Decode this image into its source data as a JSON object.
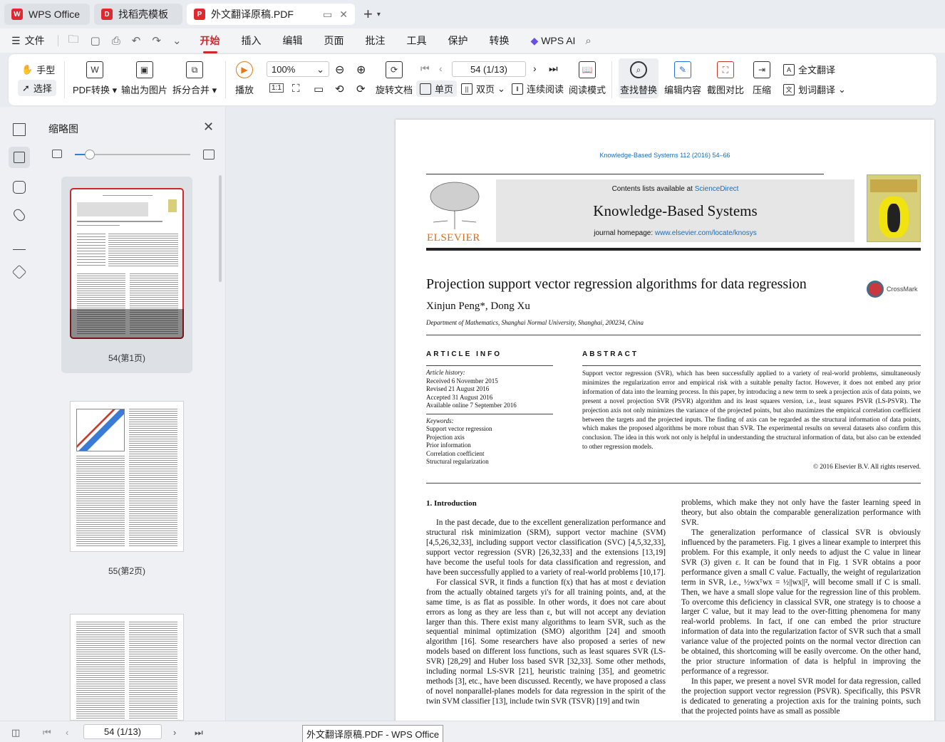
{
  "tabs": [
    {
      "label": "WPS Office",
      "icon": "wps-icon"
    },
    {
      "label": "找稻壳模板",
      "icon": "docer-icon"
    },
    {
      "label": "外文翻译原稿.PDF",
      "icon": "pdf-icon"
    }
  ],
  "menu": {
    "file": "文件",
    "tabs": [
      "开始",
      "插入",
      "编辑",
      "页面",
      "批注",
      "工具",
      "保护",
      "转换"
    ],
    "ai": "WPS AI"
  },
  "ribbon": {
    "hand": "手型",
    "select": "选择",
    "pdf_convert": "PDF转换",
    "export_image": "输出为图片",
    "split_merge": "拆分合并",
    "play": "播放",
    "zoom": "100%",
    "rotate": "旋转文档",
    "single": "单页",
    "double": "双页",
    "continuous": "连续阅读",
    "reading_mode": "阅读模式",
    "page_indicator": "54 (1/13)",
    "find_replace": "查找替换",
    "edit_content": "编辑内容",
    "screenshot_compare": "截图对比",
    "compress": "压缩",
    "full_translate": "全文翻译",
    "word_translate": "划词翻译"
  },
  "thumbnails": {
    "title": "缩略图",
    "pages": [
      {
        "label": "54(第1页)",
        "selected": true
      },
      {
        "label": "55(第2页)",
        "selected": false
      }
    ]
  },
  "paper": {
    "journal_cite": "Knowledge-Based Systems 112 (2016) 54–66",
    "contents_prefix": "Contents lists available at ",
    "contents_link": "ScienceDirect",
    "journal": "Knowledge-Based Systems",
    "homepage_prefix": "journal homepage: ",
    "homepage_link": "www.elsevier.com/locate/knosys",
    "publisher": "ELSEVIER",
    "crossmark": "CrossMark",
    "title": "Projection support vector regression algorithms for data regression",
    "authors": "Xinjun Peng*, Dong Xu",
    "affiliation": "Department of Mathematics, Shanghai Normal University, Shanghai, 200234, China",
    "article_info_head": "ARTICLE INFO",
    "abstract_head": "ABSTRACT",
    "history_label": "Article history:",
    "history": [
      "Received 6 November 2015",
      "Revised 21 August 2016",
      "Accepted 31 August 2016",
      "Available online 7 September 2016"
    ],
    "keywords_label": "Keywords:",
    "keywords": [
      "Support vector regression",
      "Projection axis",
      "Prior information",
      "Correlation coefficient",
      "Structural regularization"
    ],
    "abstract": "Support vector regression (SVR), which has been successfully applied to a variety of real-world problems, simultaneously minimizes the regularization error and empirical risk with a suitable penalty factor. However, it does not embed any prior information of data into the learning process. In this paper, by introducing a new term to seek a projection axis of data points, we present a novel projection SVR (PSVR) algorithm and its least squares version, i.e., least squares PSVR (LS-PSVR). The projection axis not only minimizes the variance of the projected points, but also maximizes the empirical correlation coefficient between the targets and the projected inputs. The finding of axis can be regarded as the structural information of data points, which makes the proposed algorithms be more robust than SVR. The experimental results on several datasets also confirm this conclusion. The idea in this work not only is helpful in understanding the structural information of data, but also can be extended to other regression models.",
    "copyright": "© 2016 Elsevier B.V. All rights reserved.",
    "intro_head": "1. Introduction",
    "intro_left_p1": "In the past decade, due to the excellent generalization performance and structural risk minimization (SRM), support vector machine (SVM) [4,5,26,32,33], including support vector classification (SVC) [4,5,32,33], support vector regression (SVR) [26,32,33] and the extensions [13,19] have become the useful tools for data classification and regression, and have been successfully applied to a variety of real-world problems [10,17].",
    "intro_left_p2": "For classical SVR, it finds a function f(x) that has at most ε deviation from the actually obtained targets yi's for all training points, and, at the same time, is as flat as possible. In other words, it does not care about errors as long as they are less than ε, but will not accept any deviation larger than this. There exist many algorithms to learn SVR, such as the sequential minimal optimization (SMO) algorithm [24] and smooth algorithm [16]. Some researchers have also proposed a series of new models based on different loss functions, such as least squares SVR (LS-SVR) [28,29] and Huber loss based SVR [32,33]. Some other methods, including normal LS-SVR [21], heuristic training [35], and geometric methods [3], etc., have been discussed. Recently, we have proposed a class of novel nonparallel-planes models for data regression in the spirit of the twin SVM classifier [13], include twin SVR (TSVR) [19] and twin",
    "intro_right_p0": "problems, which make they not only have the faster learning speed in theory, but also obtain the comparable generalization performance with SVR.",
    "intro_right_p1": "The generalization performance of classical SVR is obviously influenced by the parameters. Fig. 1 gives a linear example to interpret this problem. For this example, it only needs to adjust the C value in linear SVR (3) given ε. It can be found that in Fig. 1 SVR obtains a poor performance given a small C value. Factually, the weight of regularization term in SVR, i.e., ½wxᵀwx = ½||wx||², will become small if C is small. Then, we have a small slope value for the regression line of this problem. To overcome this deficiency in classical SVR, one strategy is to choose a larger C value, but it may lead to the over-fitting phenomena for many real-world problems. In fact, if one can embed the prior structure information of data into the regularization factor of SVR such that a small variance value of the projected points on the normal vector direction can be obtained, this shortcoming will be easily overcome. On the other hand, the prior structure information of data is helpful in improving the performance of a regressor.",
    "intro_right_p2": "In this paper, we present a novel SVR model for data regression, called the projection support vector regression (PSVR). Specifically, this PSVR is dedicated to generating a projection axis for the training points, such that the projected points have as small as possible"
  },
  "statusbar": {
    "page": "54 (1/13)",
    "tooltip": "外文翻译原稿.PDF - WPS Office"
  },
  "colors": {
    "accent": "#d0262d",
    "link": "#1a6cb8",
    "elsevier": "#e06b1b"
  }
}
